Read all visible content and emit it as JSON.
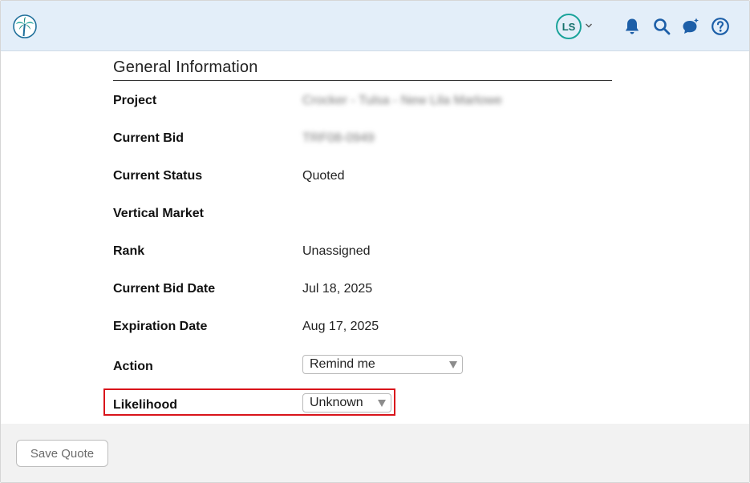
{
  "header": {
    "avatar_initials": "LS"
  },
  "section": {
    "title": "General Information"
  },
  "fields": {
    "project": {
      "label": "Project",
      "value": "Crocker - Tulsa - New Lila Marlowe"
    },
    "current_bid": {
      "label": "Current Bid",
      "value": "TRF08-0949"
    },
    "current_status": {
      "label": "Current Status",
      "value": "Quoted"
    },
    "vertical_market": {
      "label": "Vertical Market",
      "value": ""
    },
    "rank": {
      "label": "Rank",
      "value": "Unassigned"
    },
    "current_bid_date": {
      "label": "Current Bid Date",
      "value": "Jul 18, 2025"
    },
    "expiration_date": {
      "label": "Expiration Date",
      "value": "Aug 17, 2025"
    },
    "action": {
      "label": "Action",
      "selected": "Remind me"
    },
    "likelihood": {
      "label": "Likelihood",
      "selected": "Unknown"
    }
  },
  "footer": {
    "save_label": "Save Quote"
  },
  "colors": {
    "header_bg": "#e3eef9",
    "icon_blue": "#1d5fa8",
    "avatar_teal": "#1aa39a",
    "highlight_red": "#d9141b"
  }
}
